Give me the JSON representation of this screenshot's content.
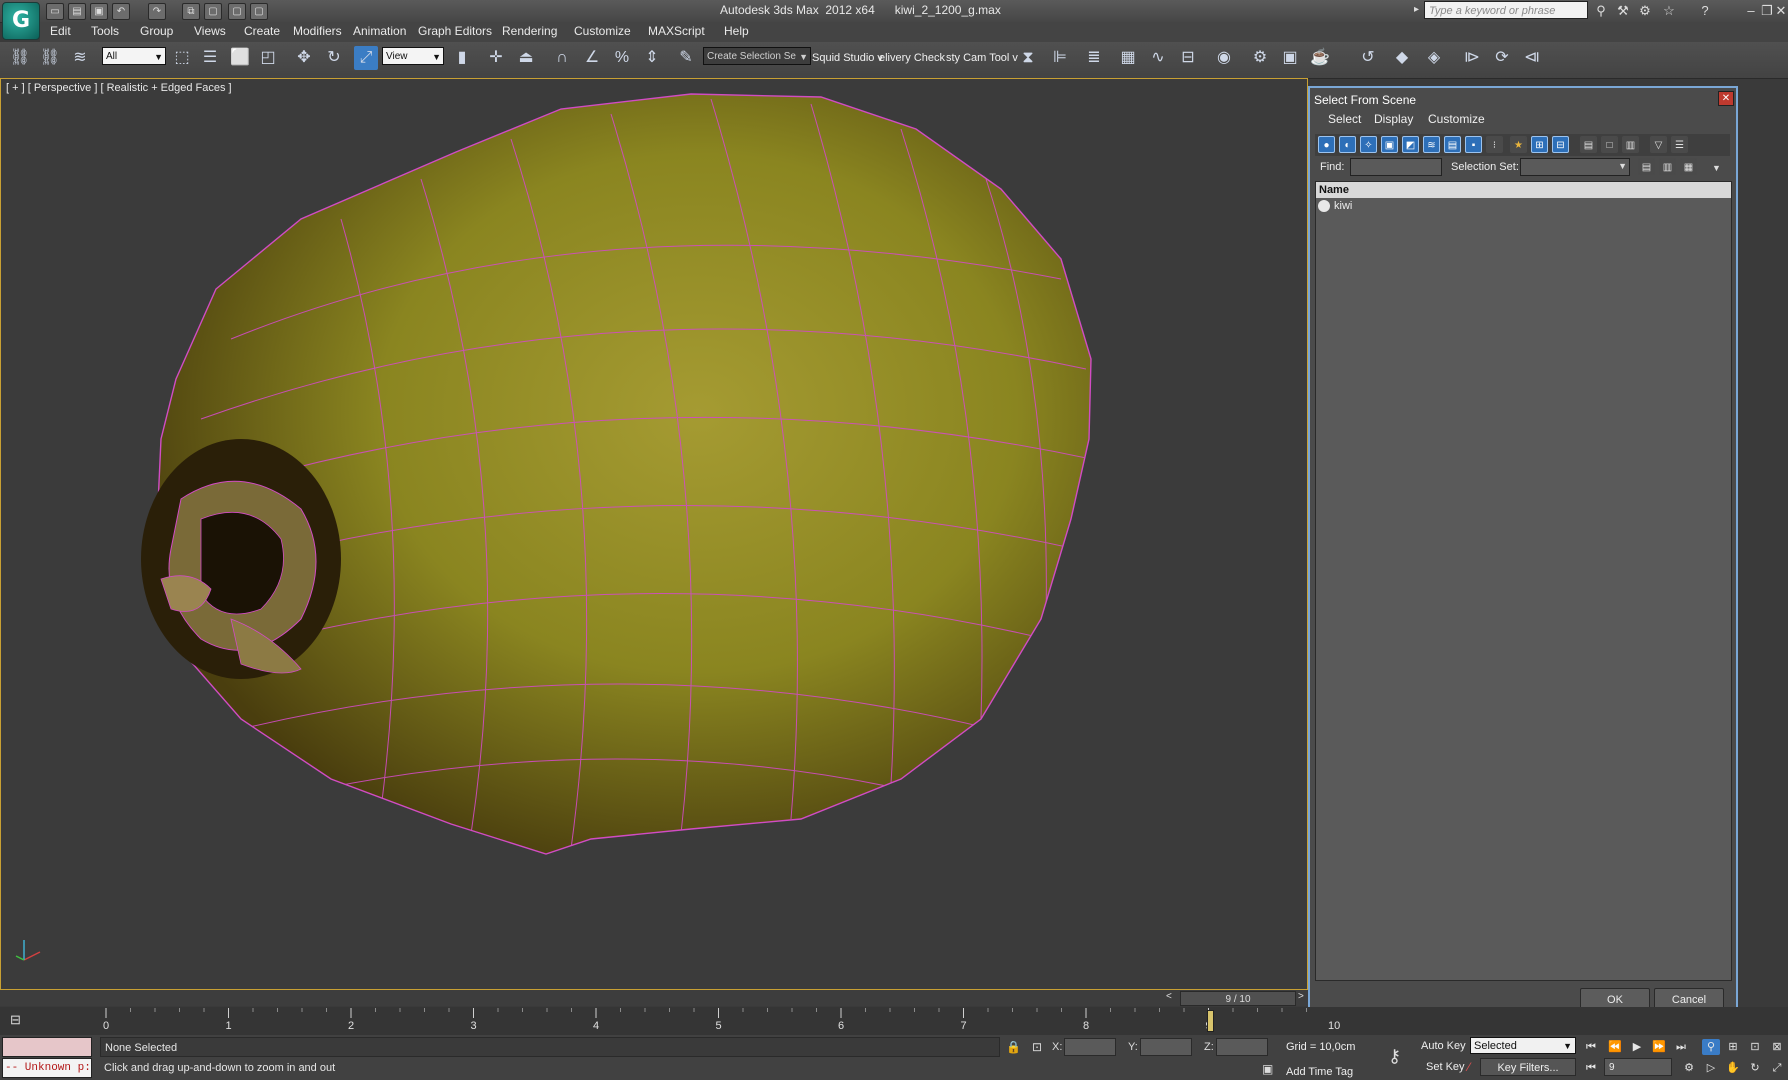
{
  "window": {
    "title": "Autodesk 3ds Max  2012 x64      kiwi_2_1200_g.max",
    "search_placeholder": "Type a keyword or phrase",
    "logo_glyph": "G"
  },
  "menu": [
    "Edit",
    "Tools",
    "Group",
    "Views",
    "Create",
    "Modifiers",
    "Animation",
    "Graph Editors",
    "Rendering",
    "Customize",
    "MAXScript",
    "Help"
  ],
  "toolbar": {
    "selection_filter": "All",
    "reference_coord": "View",
    "named_selection_placeholder": "Create Selection Se",
    "plugin_labels": [
      "Squid Studio v",
      "elivery Check",
      "sty Cam Tool v"
    ]
  },
  "viewport": {
    "label": "[ + ] [ Perspective ] [ Realistic + Edged Faces ]",
    "skin_color": "#8a8520",
    "wire_color": "#d14cc4"
  },
  "dialog": {
    "title": "Select From Scene",
    "close_glyph": "✕",
    "menu": [
      "Select",
      "Display",
      "Customize"
    ],
    "find_label": "Find:",
    "selection_set_label": "Selection Set:",
    "list_header": "Name",
    "objects": [
      "kiwi"
    ],
    "ok_label": "OK",
    "cancel_label": "Cancel"
  },
  "timeline": {
    "frame_counter": "9 / 10",
    "tick_labels": [
      "0",
      "1",
      "2",
      "3",
      "4",
      "5",
      "6",
      "7",
      "8",
      "9",
      "10"
    ],
    "current_frame": 9
  },
  "status": {
    "listener_error": "-- Unknown p:",
    "selection": "None Selected",
    "prompt": "Click and drag up-and-down to zoom in and out",
    "x_label": "X:",
    "y_label": "Y:",
    "z_label": "Z:",
    "grid": "Grid = 10,0cm",
    "add_time_tag": "Add Time Tag",
    "auto_key": "Auto Key",
    "set_key": "Set Key",
    "key_mode": "Selected",
    "key_filters": "Key Filters...",
    "frame_value": "9"
  }
}
